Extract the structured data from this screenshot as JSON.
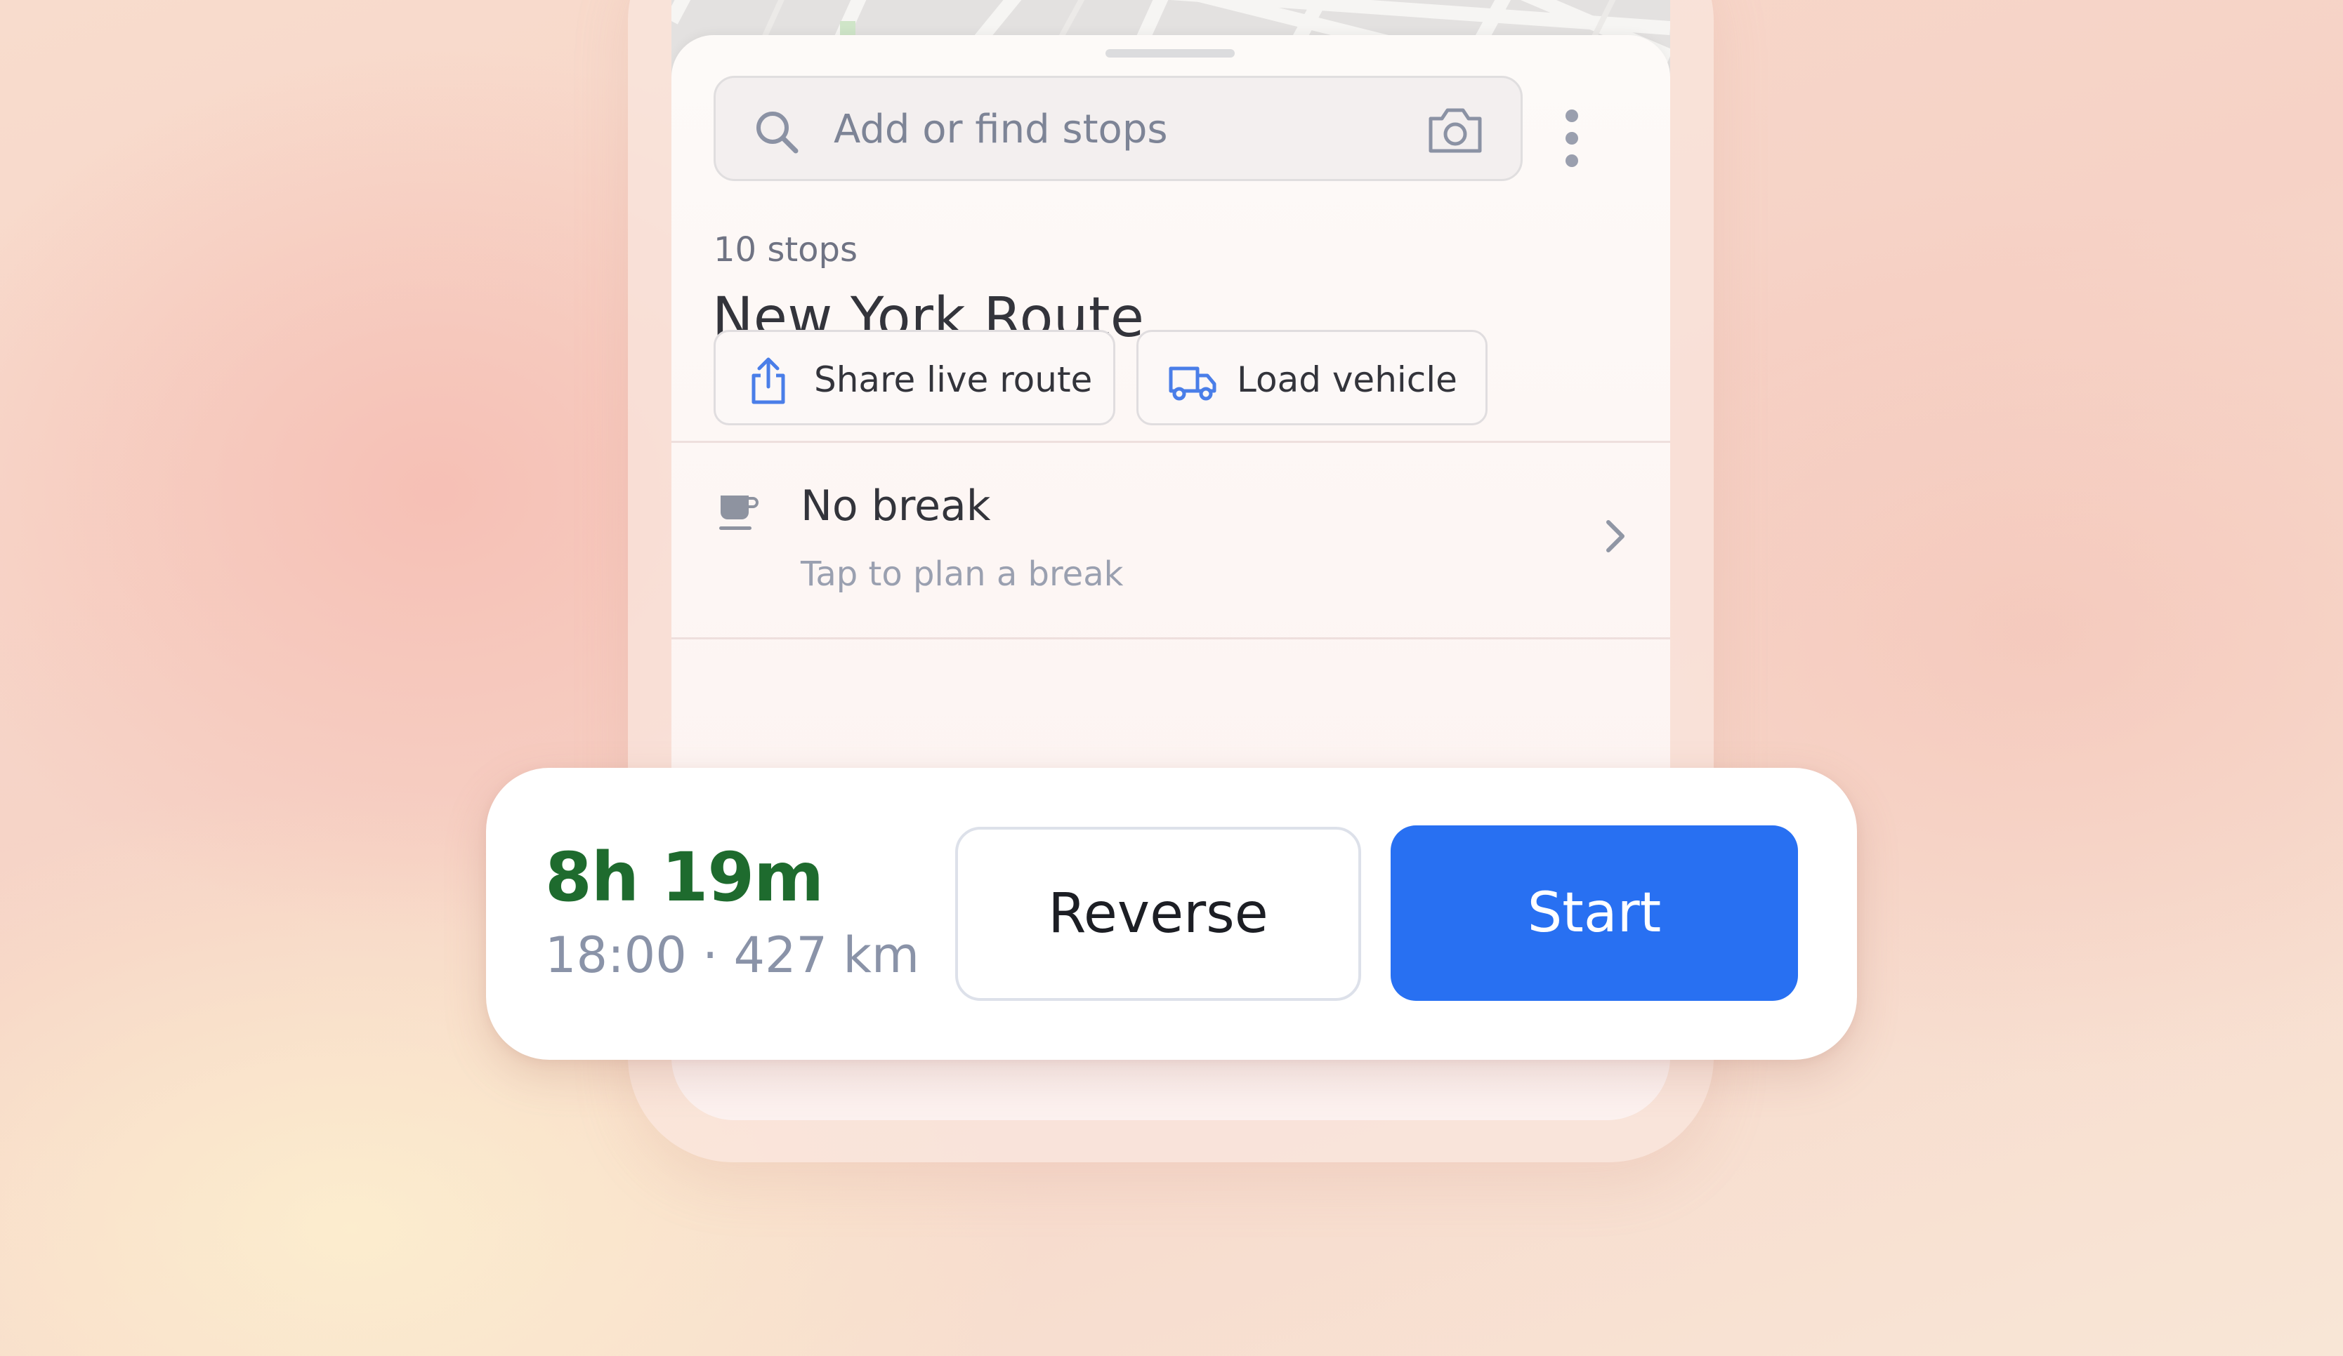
{
  "search": {
    "placeholder": "Add or find stops",
    "icon": "search-icon",
    "camera_icon": "camera-icon"
  },
  "more_menu_icon": "more-vertical-icon",
  "route": {
    "stops_count": "10 stops",
    "title": "New York Route"
  },
  "actions": {
    "share_label": "Share live route",
    "share_icon": "share-icon",
    "load_label": "Load vehicle",
    "load_icon": "truck-icon"
  },
  "break_row": {
    "title": "No break",
    "subtitle": "Tap to plan a break",
    "icon": "coffee-cup-icon",
    "chevron_icon": "chevron-right-icon"
  },
  "summary": {
    "duration": "8h 19m",
    "meta": "18:00 · 427 km",
    "reverse_label": "Reverse",
    "start_label": "Start"
  },
  "colors": {
    "accent_blue": "#2870f2",
    "duration_green": "#1e6b2e",
    "icon_blue": "#4a7ee8"
  }
}
